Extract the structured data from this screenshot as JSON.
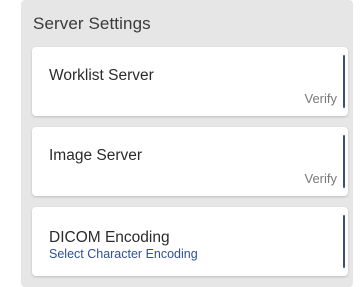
{
  "section": {
    "title": "Server Settings"
  },
  "cards": [
    {
      "title": "Worklist Server",
      "action": "Verify"
    },
    {
      "title": "Image Server",
      "action": "Verify"
    },
    {
      "title": "DICOM Encoding",
      "subtitle": "Select Character Encoding"
    }
  ],
  "colors": {
    "panel_background": "#e6e6e6",
    "card_background": "#ffffff",
    "link_blue": "#2f4f9a",
    "accent_bar": "#3a4f7a"
  }
}
